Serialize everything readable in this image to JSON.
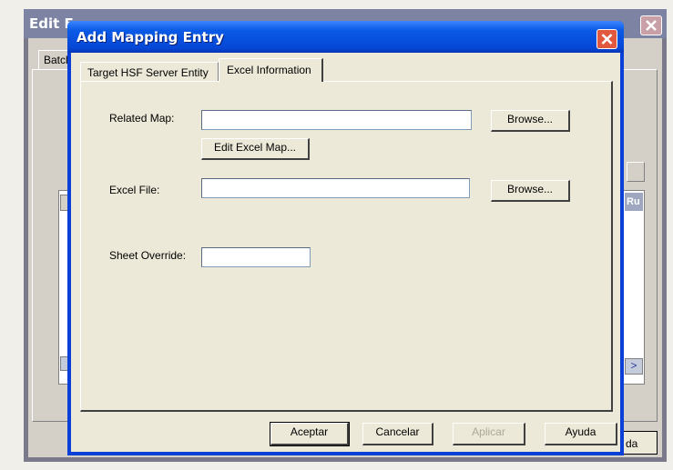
{
  "background_window": {
    "title": "Edit E",
    "tab_label": "Batcl",
    "column_header": "Ru",
    "help_button": "da"
  },
  "dialog": {
    "title": "Add Mapping Entry",
    "tabs": [
      {
        "label": "Target HSF Server Entity",
        "selected": false
      },
      {
        "label": "Excel Information",
        "selected": true
      }
    ],
    "form": {
      "related_map": {
        "label": "Related Map:",
        "value": "",
        "browse_label": "Browse..."
      },
      "edit_excel_map_label": "Edit Excel Map...",
      "excel_file": {
        "label": "Excel File:",
        "value": "",
        "browse_label": "Browse..."
      },
      "sheet_override": {
        "label": "Sheet Override:",
        "value": ""
      }
    },
    "buttons": {
      "ok": "Aceptar",
      "cancel": "Cancelar",
      "apply": "Aplicar",
      "help": "Ayuda"
    }
  },
  "colors": {
    "title_bar": "#0647d6",
    "close_button": "#e2583e",
    "dialog_face": "#ece9d8"
  }
}
